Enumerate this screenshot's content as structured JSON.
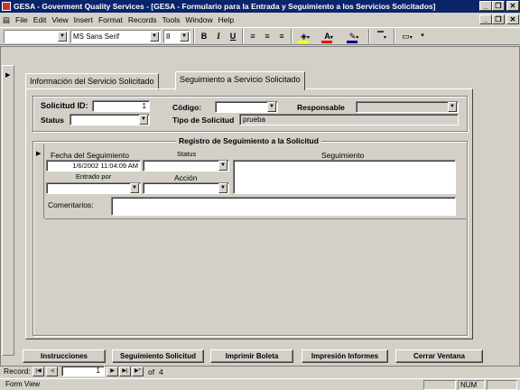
{
  "window": {
    "title": "GESA - Goverment Quality Services - [GESA - Formulario para la Entrada y Seguimiento a los Servicios Solicitados]",
    "min_glyph": "_",
    "max_glyph": "❐",
    "close_glyph": "✕"
  },
  "menu": {
    "items": [
      "File",
      "Edit",
      "View",
      "Insert",
      "Format",
      "Records",
      "Tools",
      "Window",
      "Help"
    ]
  },
  "toolbar": {
    "object_combo": "",
    "font_name": "MS Sans Serif",
    "font_size": "8",
    "bold": "B",
    "italic": "I",
    "underline": "U"
  },
  "tabs": [
    {
      "label": "Información del Servicio Solicitado"
    },
    {
      "label": "Seguimiento a Servicio Solicitado"
    }
  ],
  "header": {
    "solicitud_id_label": "Solicitud ID:",
    "solicitud_id_value": "1",
    "codigo_label": "Código:",
    "codigo_value": "",
    "responsable_label": "Responsable",
    "responsable_value": "",
    "status_label": "Status",
    "status_value": "",
    "tipo_label": "Tipo de Solicitud",
    "tipo_value": "prueba"
  },
  "registro": {
    "title": "Registro de Seguimiento a la Solicitud",
    "fecha_label": "Fecha del Seguimiento",
    "fecha_value": "1/6/2002 11:04:09 AM",
    "status_label": "Status",
    "status_value": "",
    "seguimiento_label": "Seguimiento",
    "seguimiento_value": "",
    "entrado_label": "Entrado por",
    "entrado_value": "",
    "accion_label": "Acción",
    "accion_value": "",
    "comentarios_label": "Comentarios:",
    "comentarios_value": ""
  },
  "buttons": {
    "instrucciones": "Instrucciones",
    "seguimiento": "Seguimiento Solicitud",
    "imprimir": "Imprimir Boleta",
    "impresion": "Impresión Informes",
    "cerrar": "Cerrar Ventana"
  },
  "navigator": {
    "label": "Record:",
    "current": "1",
    "of_label": "of",
    "total": "4"
  },
  "status": {
    "view": "Form View",
    "num": "NUM"
  }
}
